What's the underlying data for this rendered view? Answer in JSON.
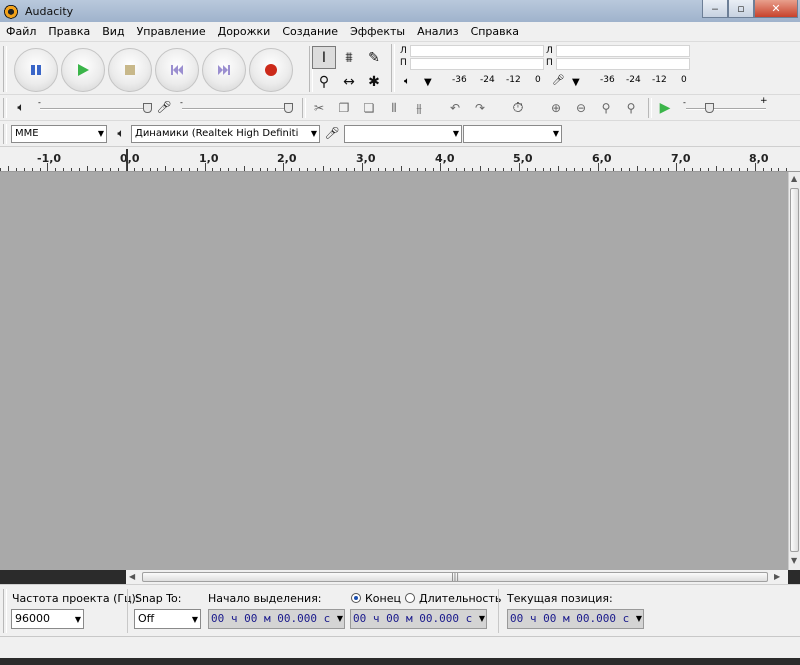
{
  "window": {
    "title": "Audacity"
  },
  "menu": [
    "Файл",
    "Правка",
    "Вид",
    "Управление",
    "Дорожки",
    "Создание",
    "Эффекты",
    "Анализ",
    "Справка"
  ],
  "meters": {
    "left_label": "Л",
    "right_label": "П",
    "scale": [
      "-36",
      "-24",
      "-12",
      "0"
    ]
  },
  "devices": {
    "host": "MME",
    "output": "Динамики (Realtek High Definiti",
    "input": "",
    "channels": ""
  },
  "ruler": [
    "-1,0",
    "0,0",
    "1,0",
    "2,0",
    "3,0",
    "4,0",
    "5,0",
    "6,0",
    "7,0",
    "8,0"
  ],
  "selection_bar": {
    "rate_label": "Частота проекта (Гц):",
    "rate_value": "96000",
    "snap_label": "Snap To:",
    "snap_value": "Off",
    "start_label": "Начало выделения:",
    "start_value": "00 ч 00 м 00.000 с",
    "end_label": "Конец",
    "length_label": "Длительность",
    "end_value": "00 ч 00 м 00.000 с",
    "position_label": "Текущая позиция:",
    "position_value": "00 ч 00 м 00.000 с"
  },
  "colors": {
    "track_bg": "#a9a9a9",
    "play_green": "#3bb54a",
    "record_red": "#cc2a1a",
    "pause_blue": "#3a66c8",
    "time_text": "#1a1a8c"
  }
}
